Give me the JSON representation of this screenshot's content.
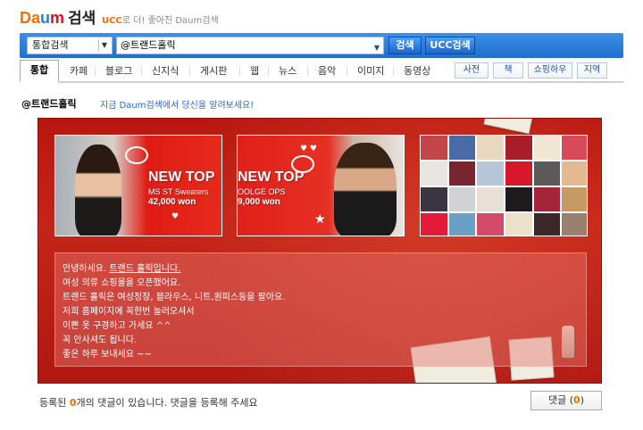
{
  "header": {
    "logo": {
      "part1": "Da",
      "part2": "u",
      "part3": "m",
      "suffix": "검색"
    },
    "slogan_ucc": "UCC",
    "slogan_rest": "로 더! 좋아진 Daum검색"
  },
  "search": {
    "scope_selected": "통합검색",
    "query": "@트랜드홀릭",
    "search_label": "검색",
    "ucc_search_label": "UCC검색"
  },
  "tabs": [
    "통합",
    "카페",
    "블로그",
    "신지식",
    "게시판",
    "웹",
    "뉴스",
    "음악",
    "이미지",
    "동영상"
  ],
  "side_buttons": [
    "사전",
    "책",
    "쇼핑하우",
    "지역"
  ],
  "result": {
    "title": "@트랜드홀릭",
    "description": "지금 Daum검색에서 당신을 알려보세요!"
  },
  "banner": {
    "thumb1": {
      "headline": "NEW TOP",
      "sub": "MS ST Sweaters",
      "price": "42,000 won"
    },
    "thumb2": {
      "headline": "NEW TOP",
      "sub": "OOLGE OPS",
      "price": "9,000 won"
    },
    "message": {
      "line1_prefix": "안녕하세요. ",
      "line1_link": "트랜드 홀릭입니다.",
      "line2": "여성 의류 쇼핑몰을 오픈했어요.",
      "line3": "트랜드 홀릭은 여성정장, 블라우스, 니트,원피스등을 팔아요.",
      "line4": "저희 홈페이지에 꼭한번 놀러오셔서",
      "line5": "이쁜 옷 구경하고 가세요 ^^",
      "line6": "꼭 안사셔도 됩니다.",
      "line7": "좋은 하루 보내세요 ~~"
    }
  },
  "footer": {
    "count_prefix": "등록된 ",
    "count": "0",
    "count_suffix": "개의 댓글이 있습니다. 댓글을 등록해 주세요",
    "comment_label": "댓글 (",
    "comment_count": "0",
    "comment_close": ")"
  },
  "colors": {
    "accent_blue": "#1f6fcd",
    "banner_red": "#c42518",
    "highlight_orange": "#ff6a00"
  }
}
